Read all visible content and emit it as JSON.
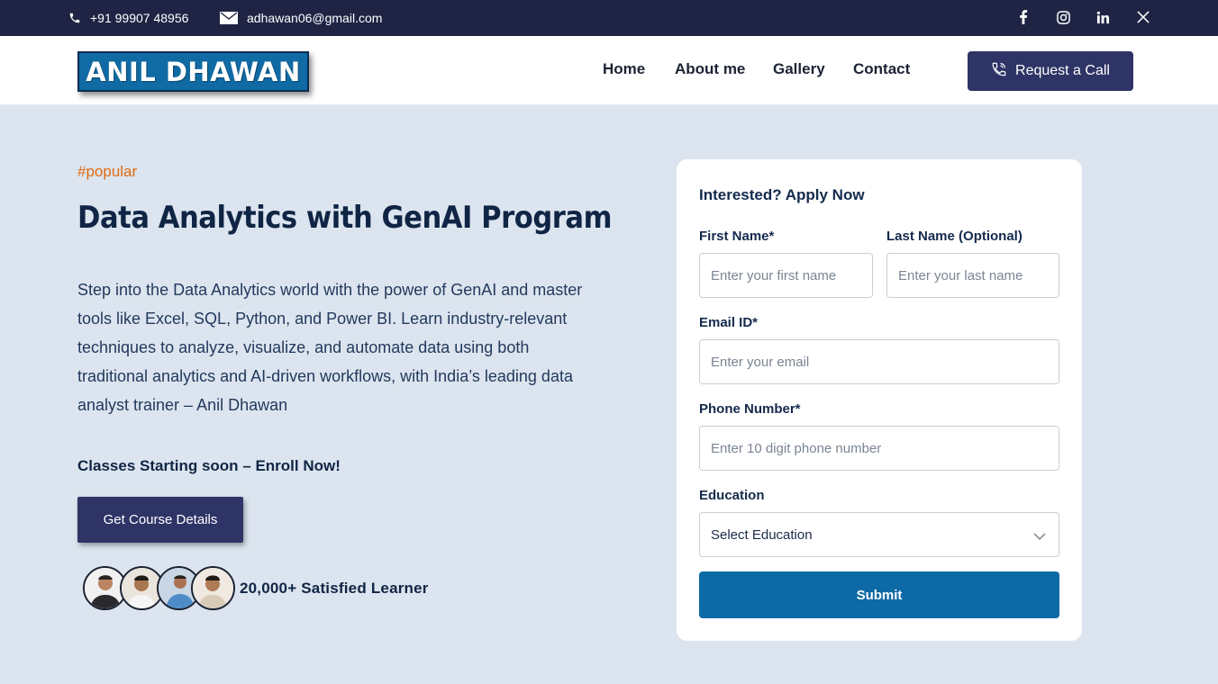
{
  "topbar": {
    "phone": "+91 99907 48956",
    "email": "adhawan06@gmail.com",
    "social_icons": [
      "facebook-icon",
      "instagram-icon",
      "linkedin-icon",
      "x-icon"
    ]
  },
  "header": {
    "logo_text": "ANIL DHAWAN",
    "nav": [
      "Home",
      "About me",
      "Gallery",
      "Contact"
    ],
    "cta_label": "Request a Call"
  },
  "hero": {
    "tag": "#popular",
    "title": "Data Analytics with GenAI Program",
    "description": "Step into the Data Analytics world with the power of GenAI and master tools like Excel, SQL, Python, and Power BI. Learn industry-relevant techniques to analyze, visualize, and automate data using both traditional analytics and AI-driven workflows, with India’s leading data analyst trainer – Anil Dhawan",
    "enroll_text": "Classes Starting soon – Enroll Now!",
    "button_label": "Get Course Details",
    "learners_text": "20,000+ Satisfied Learner"
  },
  "form": {
    "title": "Interested? Apply Now",
    "first_name": {
      "label": "First Name*",
      "placeholder": "Enter your first name",
      "value": ""
    },
    "last_name": {
      "label": "Last Name (Optional)",
      "placeholder": "Enter your last name",
      "value": ""
    },
    "email": {
      "label": "Email ID*",
      "placeholder": "Enter your email",
      "value": ""
    },
    "phone": {
      "label": "Phone Number*",
      "placeholder": "Enter 10 digit phone number",
      "value": ""
    },
    "education": {
      "label": "Education",
      "selected": "Select Education"
    },
    "submit_label": "Submit"
  },
  "colors": {
    "topbar_bg": "#1f2444",
    "page_bg": "#dce5ef",
    "brand_blue": "#0e6aa6",
    "navy_button": "#2e3466",
    "accent_orange": "#e06a12",
    "heading_text": "#102545"
  }
}
